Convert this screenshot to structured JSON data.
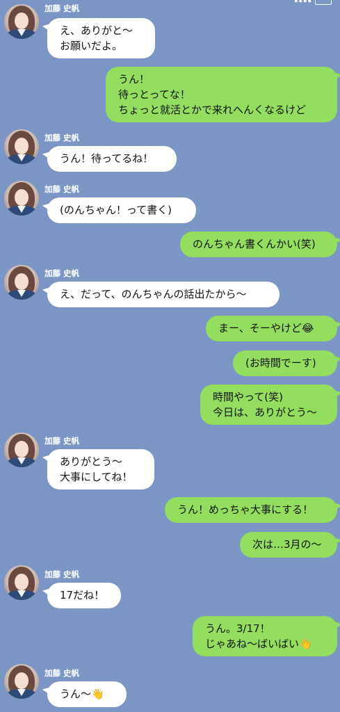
{
  "contact": {
    "name": "加藤 史帆"
  },
  "messages": [
    {
      "side": "in",
      "text": "え、ありがと〜\nお願いだよ。"
    },
    {
      "side": "out",
      "text": "うん！\n待っとってな！\nちょっと就活とかで来れへんくなるけど"
    },
    {
      "side": "in",
      "text": "うん！待ってるね！"
    },
    {
      "side": "in",
      "text": "(のんちゃん！って書く)"
    },
    {
      "side": "out",
      "text": "のんちゃん書くんかい(笑)"
    },
    {
      "side": "in",
      "text": "え、だって、のんちゃんの話出たから〜"
    },
    {
      "side": "out",
      "text": "まー、そーやけど😂"
    },
    {
      "side": "out",
      "text": "(お時間でーす)"
    },
    {
      "side": "out",
      "text": "時間やって(笑)\n今日は、ありがとう〜"
    },
    {
      "side": "in",
      "text": "ありがとう〜\n大事にしてね！"
    },
    {
      "side": "out",
      "text": "うん！めっちゃ大事にする！"
    },
    {
      "side": "out",
      "text": "次は…3月の〜"
    },
    {
      "side": "in",
      "text": "17だね！"
    },
    {
      "side": "out",
      "text": "うん。3/17！\nじゃあね〜ばいばい👋"
    },
    {
      "side": "in",
      "text": "うん〜👋"
    }
  ]
}
